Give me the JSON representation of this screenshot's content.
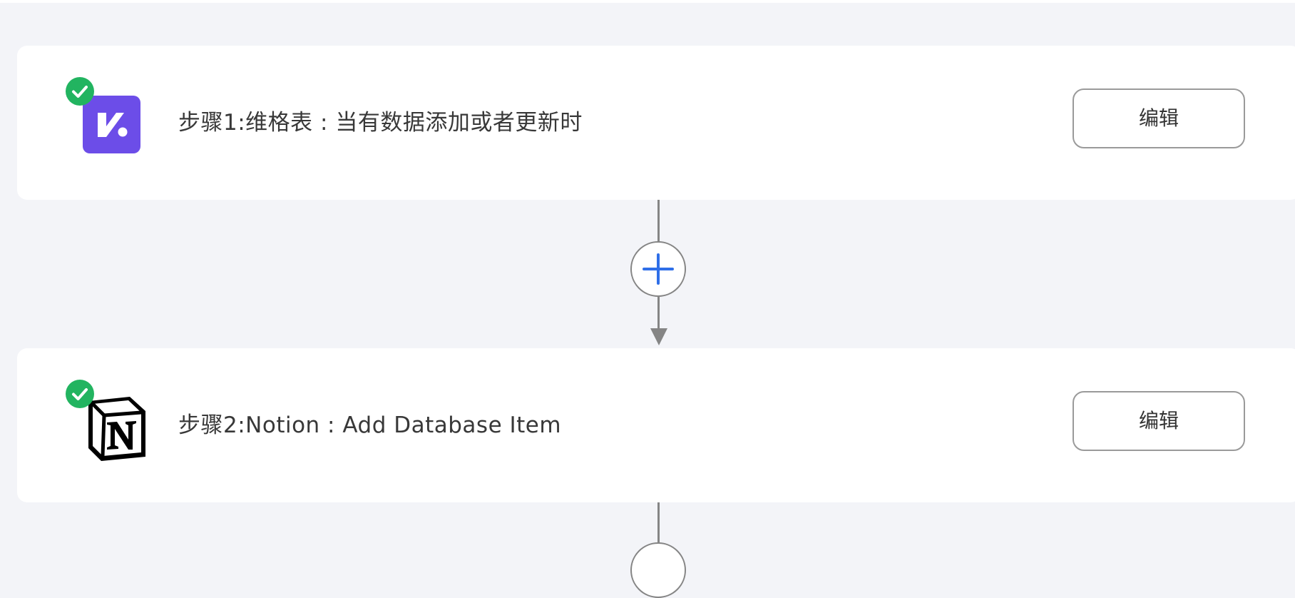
{
  "workflow": {
    "steps": [
      {
        "label": "步骤1:维格表 : 当有数据添加或者更新时",
        "app_icon": "vika-icon",
        "app_color": "#6c4de8",
        "status_icon": "check-circle-icon",
        "edit_label": "编辑"
      },
      {
        "label": "步骤2:Notion : Add Database Item",
        "app_icon": "notion-icon",
        "status_icon": "check-circle-icon",
        "edit_label": "编辑"
      }
    ]
  },
  "colors": {
    "page_background": "#f3f4f8",
    "card_background": "#ffffff",
    "status_success": "#22b460",
    "add_icon": "#2f6fe8",
    "connector": "#858585"
  }
}
